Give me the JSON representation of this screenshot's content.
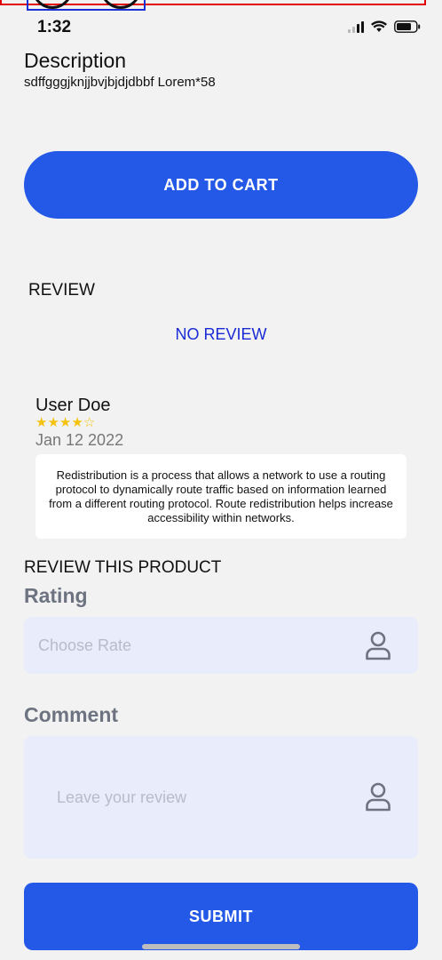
{
  "status_bar": {
    "time": "1:32"
  },
  "description": {
    "title": "Description",
    "text": "sdffgggjknjjbvjbjdjdbbf Lorem*58"
  },
  "add_to_cart": {
    "label": "ADD TO CART"
  },
  "review": {
    "heading": "REVIEW",
    "no_review": "NO REVIEW",
    "items": [
      {
        "user": "User Doe",
        "rating": 4,
        "rating_max": 5,
        "date": "Jan 12 2022",
        "text": "Redistribution is a process that allows a network to use a routing protocol to dynamically route traffic based on information learned from a different routing protocol. Route redistribution helps increase accessibility within networks."
      }
    ]
  },
  "review_form": {
    "heading": "REVIEW THIS PRODUCT",
    "rating_label": "Rating",
    "rating_placeholder": "Choose Rate",
    "comment_label": "Comment",
    "comment_placeholder": "Leave your review",
    "submit_label": "SUBMIT"
  },
  "colors": {
    "primary": "#2459e8",
    "no_review": "#1a2bd6",
    "star": "#f4c20d",
    "field_bg": "#e9ecfb"
  },
  "icons": {
    "status": [
      "signal-icon",
      "wifi-icon",
      "battery-icon"
    ],
    "field": "user-icon"
  }
}
